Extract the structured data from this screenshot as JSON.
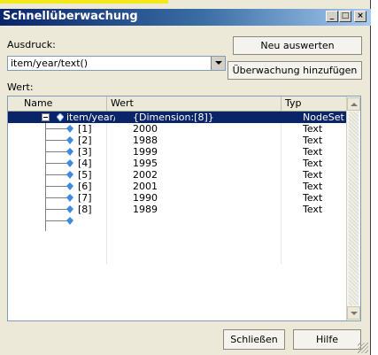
{
  "window": {
    "title": "Schnellüberwachung"
  },
  "expression": {
    "label": "Ausdruck:",
    "value": "item/year/text()"
  },
  "buttons": {
    "evaluate": "Neu auswerten",
    "add_watch": "Überwachung hinzufügen",
    "close": "Schließen",
    "help": "Hilfe"
  },
  "value_label": "Wert:",
  "table": {
    "columns": {
      "name": "Name",
      "value": "Wert",
      "type": "Typ"
    },
    "root": {
      "name": "item/year/te",
      "value": "{Dimension:[8]}",
      "type": "NodeSet"
    },
    "rows": [
      {
        "name": "[1]",
        "value": "2000",
        "type": "Text"
      },
      {
        "name": "[2]",
        "value": "1988",
        "type": "Text"
      },
      {
        "name": "[3]",
        "value": "1999",
        "type": "Text"
      },
      {
        "name": "[4]",
        "value": "1995",
        "type": "Text"
      },
      {
        "name": "[5]",
        "value": "2002",
        "type": "Text"
      },
      {
        "name": "[6]",
        "value": "2001",
        "type": "Text"
      },
      {
        "name": "[7]",
        "value": "1990",
        "type": "Text"
      },
      {
        "name": "[8]",
        "value": "1989",
        "type": "Text"
      }
    ]
  }
}
